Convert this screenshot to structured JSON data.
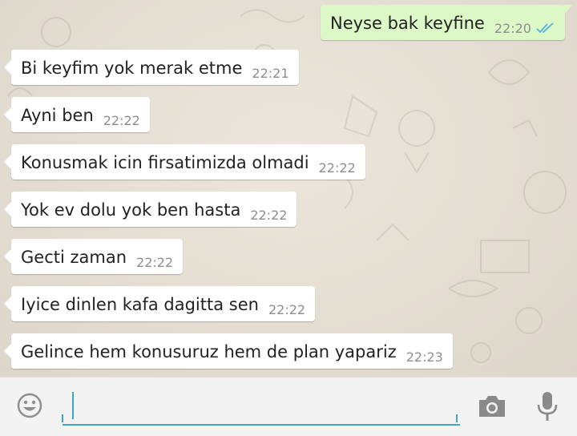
{
  "messages": [
    {
      "direction": "out",
      "text": "Neyse bak keyfine",
      "time": "22:20",
      "status": "read"
    },
    {
      "direction": "in",
      "text": "Bi keyfim yok merak etme",
      "time": "22:21"
    },
    {
      "direction": "in",
      "text": "Ayni ben",
      "time": "22:22"
    },
    {
      "direction": "in",
      "text": "Konusmak icin firsatimizda olmadi",
      "time": "22:22"
    },
    {
      "direction": "in",
      "text": "Yok ev dolu yok ben hasta",
      "time": "22:22"
    },
    {
      "direction": "in",
      "text": "Gecti zaman",
      "time": "22:22"
    },
    {
      "direction": "in",
      "text": "Iyice dinlen kafa dagitta sen",
      "time": "22:22"
    },
    {
      "direction": "in",
      "text": "Gelince hem konusuruz hem de plan yapariz",
      "time": "22:23"
    }
  ],
  "composer": {
    "value": "",
    "placeholder": "",
    "icons": [
      "smiley-icon",
      "camera-icon",
      "microphone-icon"
    ]
  },
  "colors": {
    "incoming_bubble": "#ffffff",
    "outgoing_bubble": "#dcf8c6",
    "read_ticks": "#4fb3e8",
    "accent": "#39a7c7"
  }
}
